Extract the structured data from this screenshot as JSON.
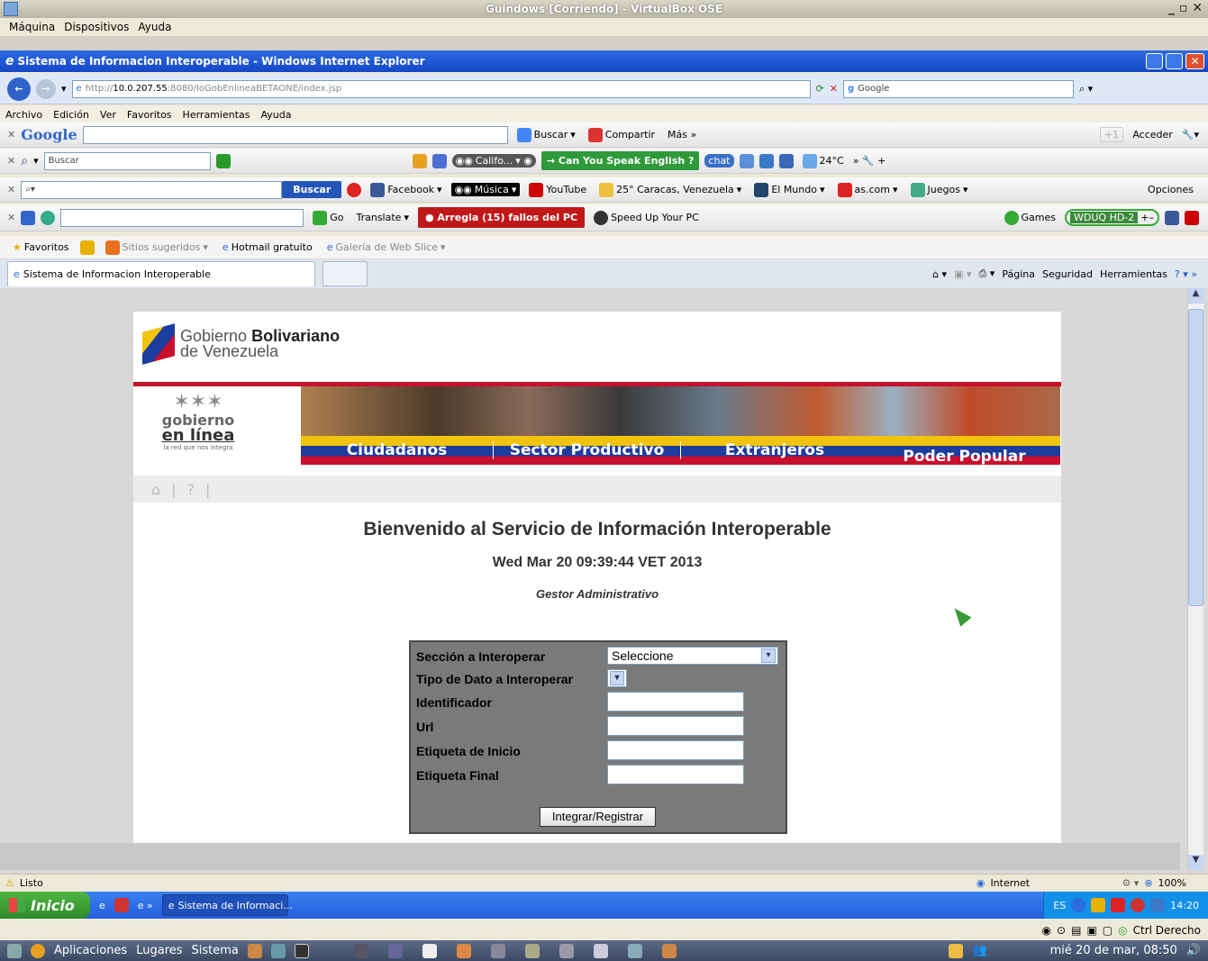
{
  "vbox": {
    "title": "Guindows [Corriendo] - VirtualBox OSE",
    "menu": [
      "Máquina",
      "Dispositivos",
      "Ayuda"
    ],
    "status_right": "Ctrl Derecho"
  },
  "ie": {
    "title": "Sistema de Informacion Interoperable - Windows Internet Explorer",
    "url_scheme": "http://",
    "url_host": "10.0.207.55",
    "url_rest": ":8080/IoGobEnlineaBETAONE/index.jsp",
    "search_placeholder": "Google",
    "menu": [
      "Archivo",
      "Edición",
      "Ver",
      "Favoritos",
      "Herramientas",
      "Ayuda"
    ],
    "tab_title": "Sistema de Informacion Interoperable"
  },
  "toolbars": {
    "google": {
      "logo": "Google",
      "buscar": "Buscar",
      "compartir": "Compartir",
      "mas": "Más »",
      "acceder": "Acceder",
      "plus": "+1"
    },
    "row2": {
      "search_placeholder": "Buscar",
      "califo": "Califo...",
      "english": "→ Can You Speak English ?",
      "chat": "chat",
      "temp": "24°C"
    },
    "ask": {
      "buscar": "Buscar",
      "facebook": "Facebook",
      "musica": "Música",
      "youtube": "YouTube",
      "weather": "25° Caracas, Venezuela",
      "elmundo": "El Mundo",
      "ascom": "as.com",
      "juegos": "Juegos",
      "opciones": "Opciones"
    },
    "row4": {
      "go": "Go",
      "translate": "Translate",
      "arregla": "● Arregla (15) fallos del PC",
      "speedup": "Speed Up Your PC",
      "games": "Games",
      "radio": "WDUQ HD-2"
    }
  },
  "favbar": {
    "favoritos": "Favoritos",
    "sitios": "Sitios sugeridos",
    "hotmail": "Hotmail gratuito",
    "galeria": "Galería de Web Slice",
    "pagina": "Página",
    "seguridad": "Seguridad",
    "herramientas": "Herramientas"
  },
  "site": {
    "gov_line1": "Gobierno",
    "gov_line1_bold": "Bolivariano",
    "gov_line2": "de Venezuela",
    "gel_line1": "gobierno",
    "gel_line2": "en línea",
    "gel_tagline": "la red que nos integra",
    "nav": [
      "Ciudadanos",
      "Sector Productivo",
      "Extranjeros",
      "Poder Popular"
    ],
    "welcome": "Bienvenido al Servicio de Información Interoperable",
    "datetime": "Wed Mar 20 09:39:44 VET 2013",
    "role": "Gestor Administrativo",
    "form": {
      "seccion": "Sección a Interoperar",
      "seccion_value": "Seleccione",
      "tipo": "Tipo de Dato a Interoperar",
      "identificador": "Identificador",
      "url": "Url",
      "etiqueta_inicio": "Etiqueta de Inicio",
      "etiqueta_final": "Etiqueta Final",
      "submit": "Integrar/Registrar"
    }
  },
  "status": {
    "text": "Listo",
    "zone": "Internet",
    "zoom": "100%"
  },
  "taskbar": {
    "start": "Inicio",
    "task": "Sistema de Informaci...",
    "lang": "ES",
    "clock": "14:20"
  },
  "gnome": {
    "apps": "Aplicaciones",
    "places": "Lugares",
    "system": "Sistema",
    "datetime": "mié 20 de mar, 08:50"
  },
  "colors": {
    "ie_blue": "#1646c6",
    "start_green": "#3c9a33",
    "form_gray": "#7a7a7a",
    "flag_yellow": "#f2c30b",
    "flag_blue": "#1c3c9e",
    "flag_red": "#c8102e"
  }
}
